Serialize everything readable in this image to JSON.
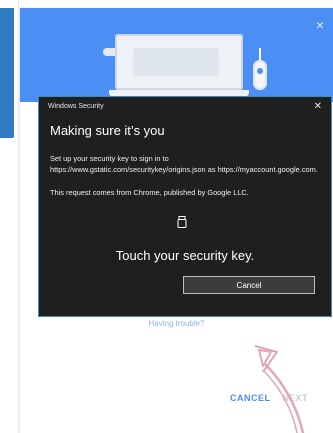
{
  "colors": {
    "google_blue": "#4b8ef4",
    "ws_bg": "#1f1f1f",
    "ws_border": "#3a8ac8",
    "arrow_pink": "#e2a7b5",
    "left_blue": "#2f7bc2"
  },
  "google_dialog": {
    "close_icon": "×",
    "link_text": "Having trouble?",
    "cancel_label": "CANCEL",
    "next_label": "NEXT"
  },
  "windows_security": {
    "title": "Windows Security",
    "close_icon": "✕",
    "heading": "Making sure it’s you",
    "body_1": "Set up your security key to sign in to https://www.gstatic.com/securitykey/origins.json as https://myaccount.google.com.",
    "body_2": "This request comes from Chrome, published by Google LLC.",
    "touch_text": "Touch your security key.",
    "cancel_label": "Cancel",
    "icon": "usb-key-icon"
  },
  "annotation": {
    "icon": "curved-arrow-icon"
  }
}
